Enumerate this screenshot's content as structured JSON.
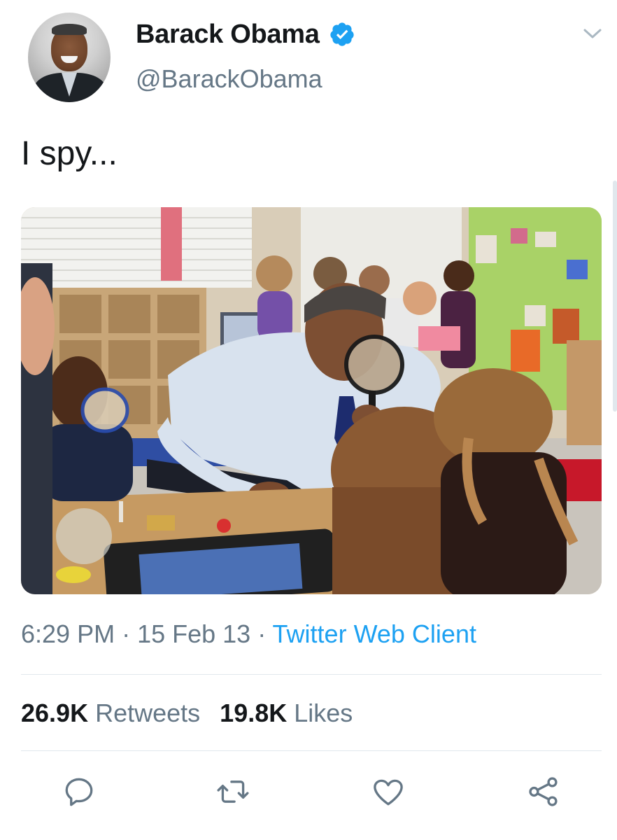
{
  "author": {
    "name": "Barack Obama",
    "handle": "@BarackObama",
    "verified": true
  },
  "tweet": {
    "text": "I spy..."
  },
  "meta": {
    "time": "6:29 PM",
    "separator": " · ",
    "date": "15 Feb 13",
    "client": "Twitter Web Client"
  },
  "stats": {
    "retweets_count": "26.9K",
    "retweets_label": "Retweets",
    "likes_count": "19.8K",
    "likes_label": "Likes"
  },
  "icons": {
    "verified": "verified-badge-icon",
    "menu": "chevron-down-icon",
    "reply": "reply-icon",
    "retweet": "retweet-icon",
    "like": "heart-icon",
    "share": "share-icon"
  },
  "colors": {
    "accent": "#1da1f2",
    "secondary_text": "#657786",
    "primary_text": "#14171a",
    "divider": "#e1e8ed"
  }
}
